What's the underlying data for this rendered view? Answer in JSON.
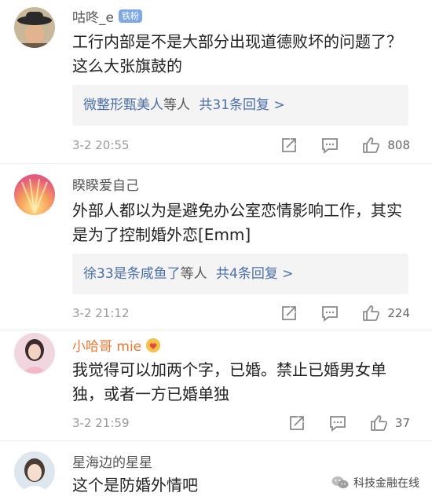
{
  "comments": [
    {
      "username": "咕咚_e",
      "badge": "铁粉",
      "text": "工行内部是不是大部分出现道德败坏的问题了？这么大张旗鼓的",
      "reply_names": "微整形甄美人",
      "reply_mid": "等人",
      "reply_count_text": "共31条回复 >",
      "time": "3-2 20:55",
      "likes": "808"
    },
    {
      "username": "睽睽爱自己",
      "text": "外部人都以为是避免办公室恋情影响工作，其实是为了控制婚外恋[Emm]",
      "reply_names": "徐33是条咸鱼了",
      "reply_mid": "等人",
      "reply_count_text": "共4条回复 >",
      "time": "3-2 21:12",
      "likes": "224"
    },
    {
      "username": "小哈哥 mie",
      "text": "我觉得可以加两个字，已婚。禁止已婚男女单独，或者一方已婚单独",
      "time": "3-2 21:59",
      "likes": "37"
    },
    {
      "username": "星海边的星星",
      "text": "这个是防婚外情吧"
    }
  ],
  "watermark": {
    "text": "科技金融在线"
  },
  "icons": {
    "share": "share-icon",
    "comment": "comment-icon",
    "like": "thumbs-up-icon"
  },
  "colors": {
    "link": "#4a6ea9",
    "vip_name": "#e8772e",
    "badge": "#7fa9e6"
  }
}
